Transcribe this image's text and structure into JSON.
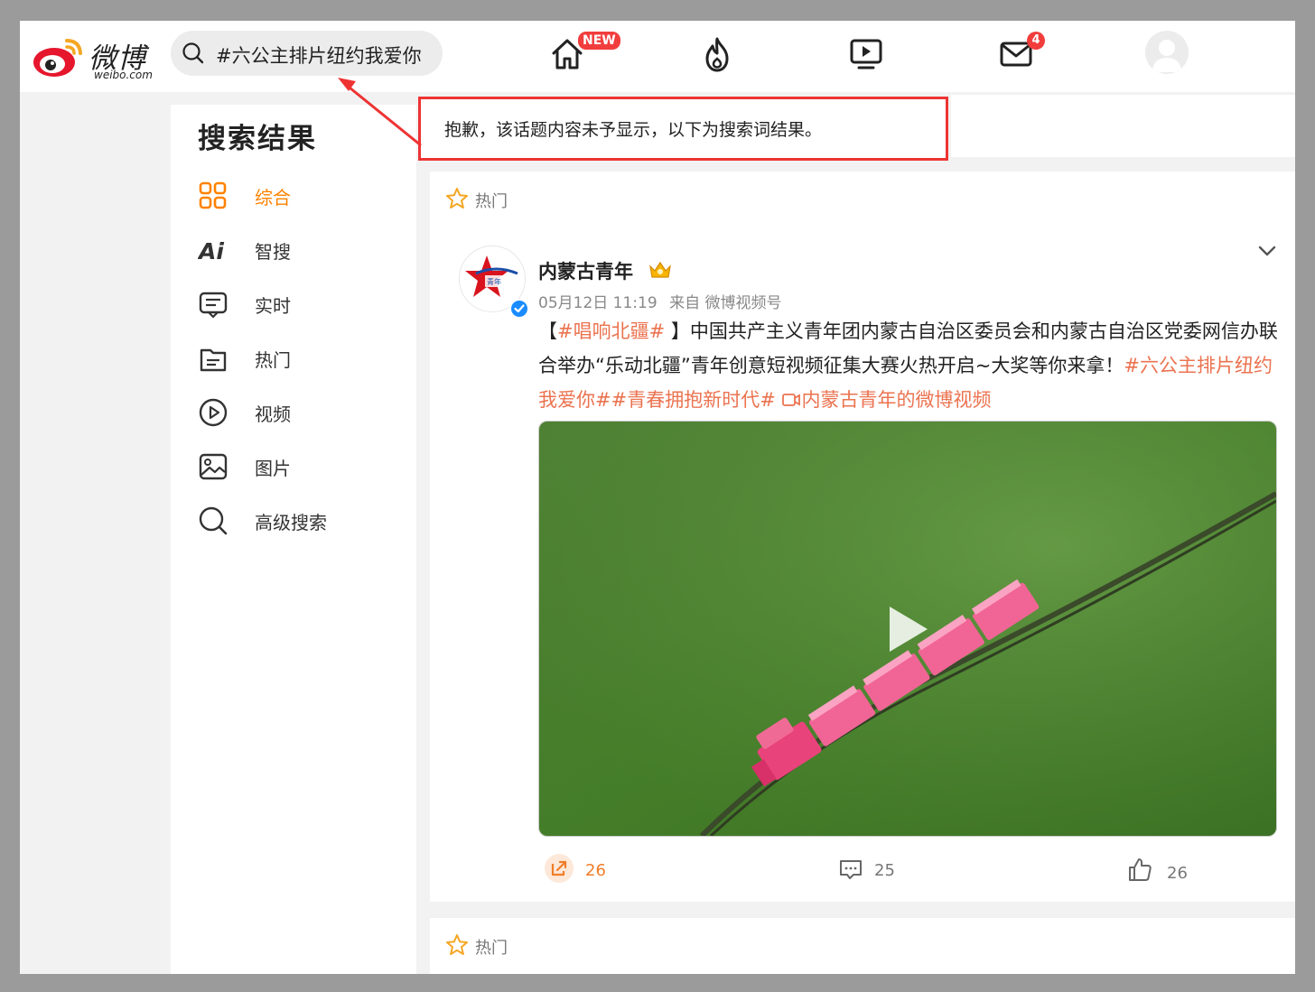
{
  "topbar": {
    "logo_text": "微博",
    "logo_sub": "weibo.com",
    "search_value": "#六公主排片纽约我爱你",
    "nav": [
      {
        "name": "home",
        "badge": "NEW"
      },
      {
        "name": "hot"
      },
      {
        "name": "video"
      },
      {
        "name": "messages",
        "badge": "4"
      },
      {
        "name": "profile"
      }
    ]
  },
  "notice": {
    "text": "抱歉，该话题内容未予显示，以下为搜索词结果。"
  },
  "sidebar": {
    "title": "搜索结果",
    "items": [
      {
        "label": "综合",
        "icon": "grid-icon",
        "active": true
      },
      {
        "label": "智搜",
        "icon": "ai-icon"
      },
      {
        "label": "实时",
        "icon": "realtime-icon"
      },
      {
        "label": "热门",
        "icon": "hot-doc-icon"
      },
      {
        "label": "视频",
        "icon": "play-circle-icon"
      },
      {
        "label": "图片",
        "icon": "image-icon"
      },
      {
        "label": "高级搜索",
        "icon": "search-icon"
      }
    ]
  },
  "post": {
    "tag": "热门",
    "author": "内蒙古青年",
    "date": "05月12日 11:19",
    "source": "来自 微博视频号",
    "text_bracket_open": "【",
    "topic1": "#唱响北疆#",
    "text_main": "】中国共产主义青年团内蒙古自治区委员会和内蒙古自治区党委网信办联合举办“乐动北疆”青年创意短视频征集大赛火热开启~大奖等你来拿！",
    "topic2": "#六公主排片纽约我爱你#",
    "topic3": "#青春拥抱新时代#",
    "video_link": "内蒙古青年的微博视频",
    "avatar_text": "内蒙古青年",
    "reposts": "26",
    "comments": "25",
    "likes": "26"
  },
  "post2": {
    "tag": "热门"
  },
  "colors": {
    "accent": "#ff8200",
    "link": "#eb7350",
    "notice_border": "#ee3333",
    "badge": "#f23d3d",
    "verify": "#1a8cff"
  }
}
